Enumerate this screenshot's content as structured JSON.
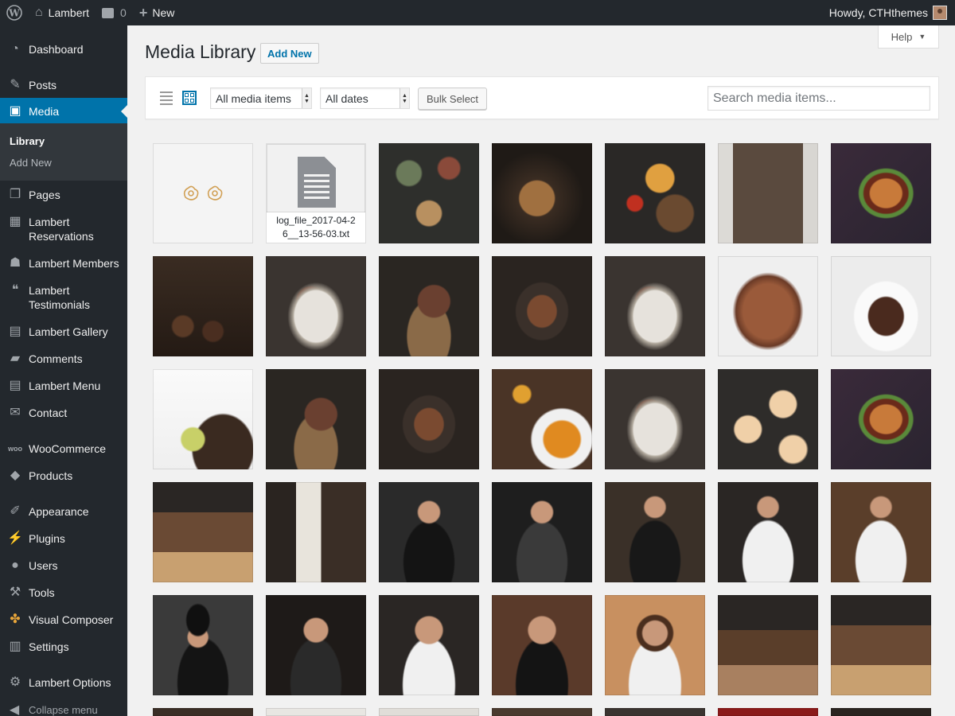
{
  "adminbar": {
    "site_name": "Lambert",
    "comments_count": "0",
    "new_label": "New",
    "greeting": "Howdy, CTHthemes"
  },
  "sidebar": {
    "items": [
      {
        "label": "Dashboard",
        "icon": "dashboard-icon"
      },
      {
        "label": "Posts",
        "icon": "pushpin-icon"
      },
      {
        "label": "Media",
        "icon": "media-icon"
      },
      {
        "label": "Pages",
        "icon": "pages-icon"
      },
      {
        "label": "Lambert Reservations",
        "icon": "calendar-icon"
      },
      {
        "label": "Lambert Members",
        "icon": "groups-icon"
      },
      {
        "label": "Lambert Testimonials",
        "icon": "testimonial-icon"
      },
      {
        "label": "Lambert Gallery",
        "icon": "gallery-icon"
      },
      {
        "label": "Comments",
        "icon": "comments-icon"
      },
      {
        "label": "Lambert Menu",
        "icon": "menu-gallery-icon"
      },
      {
        "label": "Contact",
        "icon": "email-icon"
      },
      {
        "label": "WooCommerce",
        "icon": "woocommerce-icon"
      },
      {
        "label": "Products",
        "icon": "products-icon"
      },
      {
        "label": "Appearance",
        "icon": "paintbrush-icon"
      },
      {
        "label": "Plugins",
        "icon": "plugins-icon"
      },
      {
        "label": "Users",
        "icon": "users-icon"
      },
      {
        "label": "Tools",
        "icon": "wrench-icon"
      },
      {
        "label": "Visual Composer",
        "icon": "visual-composer-icon"
      },
      {
        "label": "Settings",
        "icon": "settings-icon"
      },
      {
        "label": "Lambert Options",
        "icon": "gear-icon"
      }
    ],
    "submenu": {
      "library": "Library",
      "add_new": "Add New"
    },
    "collapse_label": "Collapse menu"
  },
  "header": {
    "title": "Media Library",
    "add_new_label": "Add New",
    "help_label": "Help"
  },
  "toolbar": {
    "type_filter": "All media items",
    "date_filter": "All dates",
    "bulk_select_label": "Bulk Select",
    "search_placeholder": "Search media items..."
  },
  "media": {
    "file_name": "log_file_2017-04-26__13-56-03.txt",
    "thumb_icons": [
      "logo-thumbnail",
      "document-icon",
      "food-photo",
      "chef-portrait",
      "restaurant-interior-photo"
    ]
  },
  "colors": {
    "admin_dark": "#23282d",
    "accent": "#0073aa",
    "background": "#f1f1f1"
  }
}
